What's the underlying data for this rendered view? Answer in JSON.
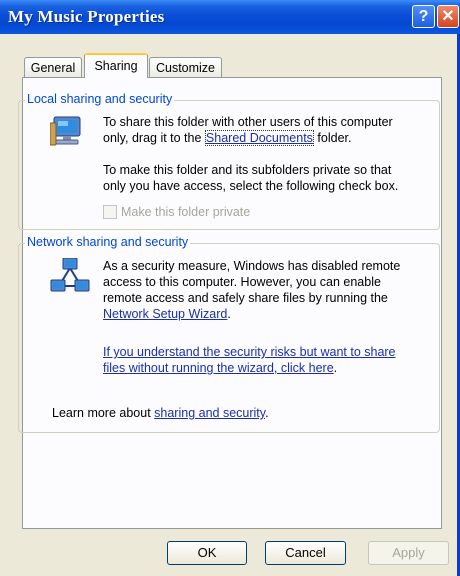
{
  "window": {
    "title": "My Music Properties",
    "help_glyph": "?",
    "close_glyph": "✕"
  },
  "tabs": [
    {
      "label": "General"
    },
    {
      "label": "Sharing"
    },
    {
      "label": "Customize"
    }
  ],
  "local": {
    "legend": "Local sharing and security",
    "line1": "To share this folder with other users of this computer",
    "line2_pre": "only, drag it to the ",
    "line2_link": "Shared Documents",
    "line2_post": " folder.",
    "line3": "To make this folder and its subfolders private so that",
    "line4": "only you have access, select the following check box.",
    "checkbox_label": "Make this folder private"
  },
  "network": {
    "legend": "Network sharing and security",
    "line1": "As a security measure, Windows has disabled remote",
    "line2": "access to this computer. However, you can enable",
    "line3": "remote access and safely share files by running the",
    "wizard_link": "Network Setup Wizard",
    "wizard_suffix": ".",
    "risk_link_1": "If you understand the security risks but want to share",
    "risk_link_2": "files without running the wizard, click here",
    "risk_suffix": ".",
    "learn_pre": "Learn more about ",
    "learn_link": "sharing and security",
    "learn_post": "."
  },
  "buttons": {
    "ok": "OK",
    "cancel": "Cancel",
    "apply": "Apply"
  },
  "colors": {
    "titlebar": "#0648d0",
    "face": "#ece9d8",
    "link": "#1a2fa8",
    "group_label": "#0046d5"
  }
}
